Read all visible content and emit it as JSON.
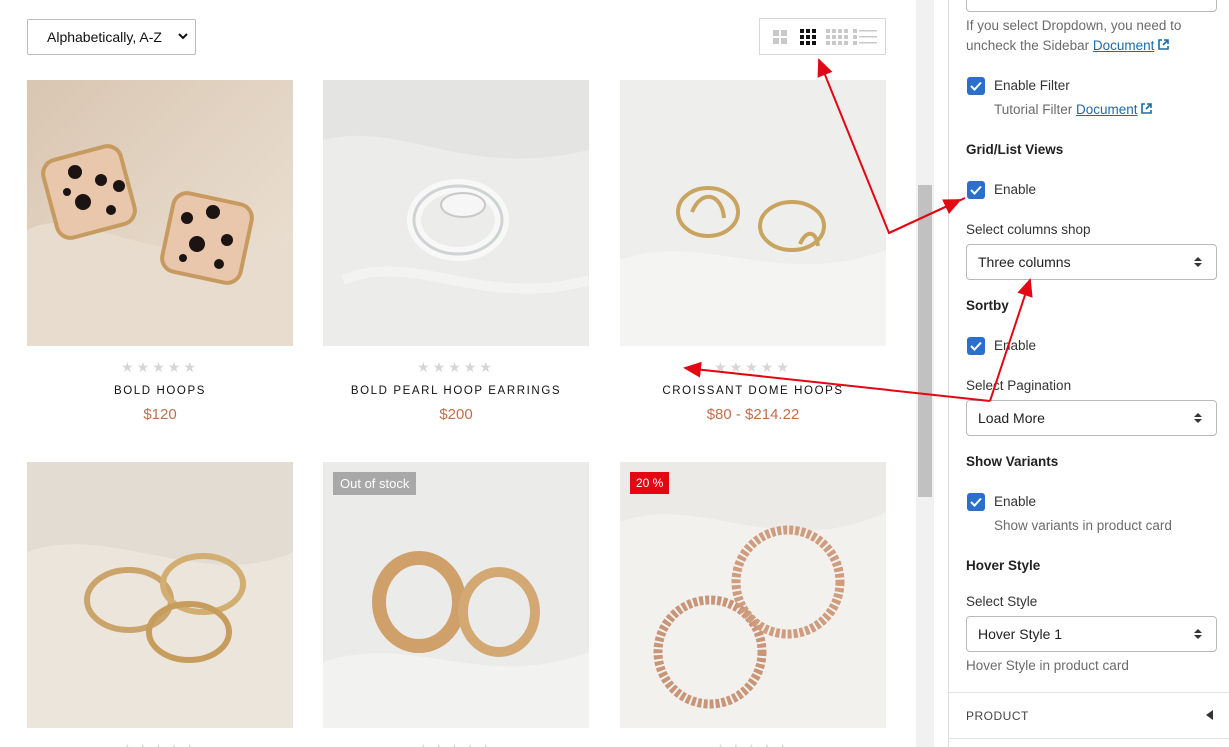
{
  "toolbar": {
    "sort_value": "Alphabetically, A-Z",
    "view_icons": [
      "grid-2-icon",
      "grid-3-icon",
      "grid-4-icon",
      "list-icon"
    ],
    "active_view_index": 1
  },
  "products": [
    {
      "name": "BOLD HOOPS",
      "price": "$120",
      "rating": 0,
      "badge": ""
    },
    {
      "name": "BOLD PEARL HOOP EARRINGS",
      "price": "$200",
      "rating": 0,
      "badge": ""
    },
    {
      "name": "CROISSANT DOME HOOPS",
      "price": "$80 - $214.22",
      "rating": 0,
      "badge": ""
    },
    {
      "name": "",
      "price": "",
      "rating": 0,
      "badge": ""
    },
    {
      "name": "",
      "price": "",
      "rating": 0,
      "badge": "Out of stock"
    },
    {
      "name": "",
      "price": "",
      "rating": 0,
      "badge": "20 %"
    }
  ],
  "settings": {
    "dropdown_note": "If you select Dropdown, you need to",
    "dropdown_note2": "uncheck the Sidebar",
    "document_link": "Document",
    "enable_filter": {
      "label": "Enable Filter",
      "checked": true
    },
    "tutorial_filter": "Tutorial Filter",
    "grid_list": {
      "heading": "Grid/List Views",
      "enable_label": "Enable",
      "checked": true
    },
    "columns": {
      "label": "Select columns shop",
      "value": "Three columns"
    },
    "sortby": {
      "heading": "Sortby",
      "enable_label": "Enable",
      "checked": true
    },
    "pagination": {
      "label": "Select Pagination",
      "value": "Load More"
    },
    "variants": {
      "heading": "Show Variants",
      "enable_label": "Enable",
      "checked": true,
      "note": "Show variants in product card"
    },
    "hover": {
      "heading": "Hover Style",
      "label": "Select Style",
      "value": "Hover Style 1",
      "note": "Hover Style in product card"
    },
    "accordion_label": "PRODUCT"
  },
  "colors": {
    "accent": "#2c6ecb",
    "price": "#c1704c",
    "sale": "#e30613",
    "annotation": "#e30613"
  }
}
